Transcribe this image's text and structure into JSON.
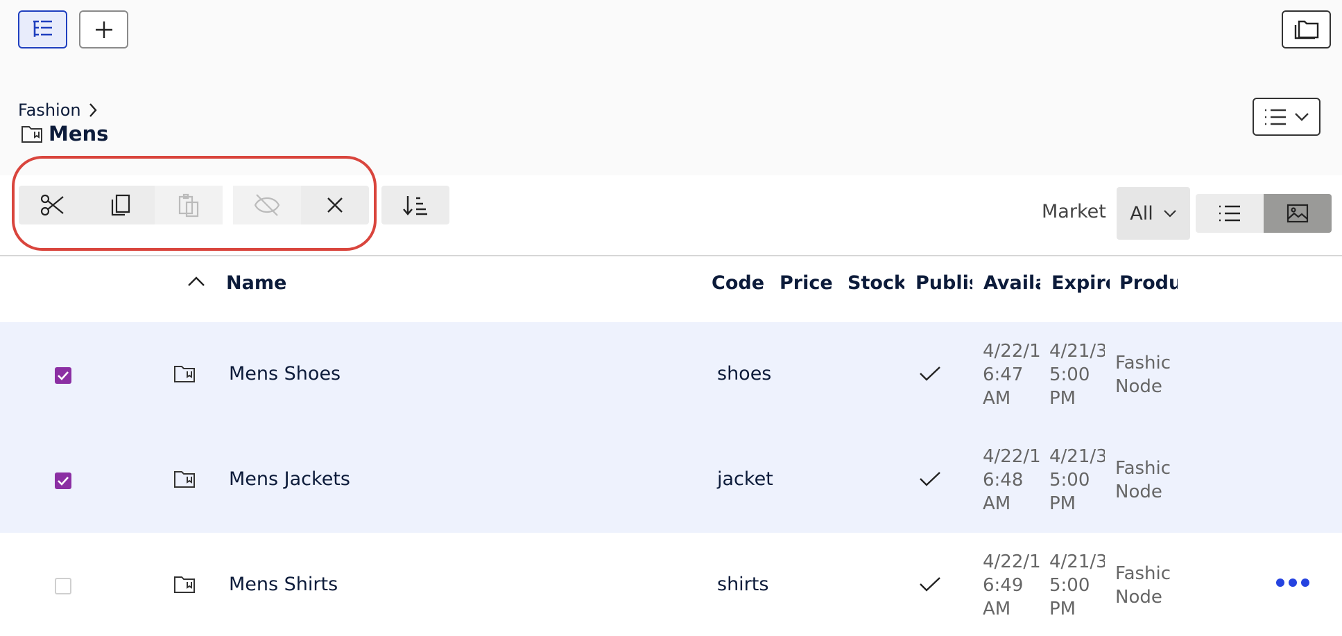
{
  "breadcrumb": {
    "parent": "Fashion",
    "current": "Mens"
  },
  "toolbar": {
    "cut_icon": "scissors-icon",
    "copy_icon": "copy-icon",
    "paste_icon": "paste-icon",
    "unlink_icon": "unlink-icon",
    "delete_icon": "close-icon",
    "sort_icon": "sort-icon"
  },
  "filters": {
    "market_label": "Market",
    "market_value": "All"
  },
  "table": {
    "columns": [
      "Name",
      "Code",
      "Price",
      "Stock",
      "Publis",
      "Availal",
      "Expire",
      "Produ"
    ],
    "rows": [
      {
        "name": "Mens Shoes",
        "code": "shoes",
        "selected": true,
        "published": true,
        "available": "4/22/1\n6:47\nAM",
        "expires": "4/21/3\n5:00\nPM",
        "product": "Fashic\nNode"
      },
      {
        "name": "Mens Jackets",
        "code": "jacket",
        "selected": true,
        "published": true,
        "available": "4/22/1\n6:48\nAM",
        "expires": "4/21/3\n5:00\nPM",
        "product": "Fashic\nNode"
      },
      {
        "name": "Mens Shirts",
        "code": "shirts",
        "selected": false,
        "published": true,
        "available": "4/22/1\n6:49\nAM",
        "expires": "4/21/3\n5:00\nPM",
        "product": "Fashic\nNode"
      }
    ]
  },
  "colors": {
    "accent": "#1f3fbf",
    "checkbox": "#8b2fa3",
    "selected_row": "#eef2fd",
    "highlight": "#d9453d",
    "more_dots": "#2543e0"
  }
}
